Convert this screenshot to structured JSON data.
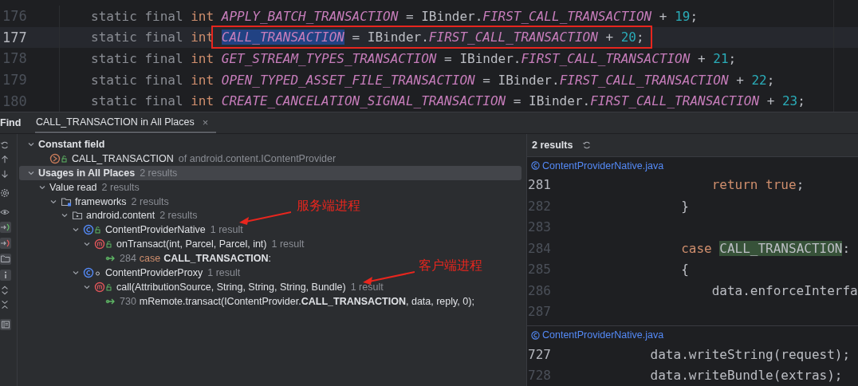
{
  "editor": {
    "lines": [
      {
        "number": "176",
        "current": false,
        "tokens": [
          {
            "t": "static final ",
            "kind": "keyword"
          },
          {
            "t": "int ",
            "kind": "type"
          },
          {
            "t": "APPLY_BATCH_TRANSACTION",
            "kind": "const"
          },
          {
            "t": " = IBinder.",
            "kind": "plain"
          },
          {
            "t": "FIRST_CALL_TRANSACTION",
            "kind": "const"
          },
          {
            "t": " + ",
            "kind": "plain"
          },
          {
            "t": "19",
            "kind": "number"
          },
          {
            "t": ";",
            "kind": "plain"
          }
        ]
      },
      {
        "number": "177",
        "current": true,
        "tokens": [
          {
            "t": "static final ",
            "kind": "keyword"
          },
          {
            "t": "int ",
            "kind": "type"
          }
        ],
        "boxed_tokens": [
          {
            "t": "CALL_TRANSACTION",
            "kind": "const",
            "selected": true
          },
          {
            "t": " = IBinder.",
            "kind": "plain"
          },
          {
            "t": "FIRST_CALL_TRANSACTION",
            "kind": "const"
          },
          {
            "t": " + ",
            "kind": "plain"
          },
          {
            "t": "20",
            "kind": "number"
          },
          {
            "t": ";",
            "kind": "plain"
          }
        ]
      },
      {
        "number": "178",
        "current": false,
        "tokens": [
          {
            "t": "static final ",
            "kind": "keyword"
          },
          {
            "t": "int ",
            "kind": "type"
          },
          {
            "t": "GET_STREAM_TYPES_TRANSACTION",
            "kind": "const"
          },
          {
            "t": " = IBinder.",
            "kind": "plain"
          },
          {
            "t": "FIRST_CALL_TRANSACTION",
            "kind": "const"
          },
          {
            "t": " + ",
            "kind": "plain"
          },
          {
            "t": "21",
            "kind": "number"
          },
          {
            "t": ";",
            "kind": "plain"
          }
        ]
      },
      {
        "number": "179",
        "current": false,
        "tokens": [
          {
            "t": "static final ",
            "kind": "keyword"
          },
          {
            "t": "int ",
            "kind": "type"
          },
          {
            "t": "OPEN_TYPED_ASSET_FILE_TRANSACTION",
            "kind": "const"
          },
          {
            "t": " = IBinder.",
            "kind": "plain"
          },
          {
            "t": "FIRST_CALL_TRANSACTION",
            "kind": "const"
          },
          {
            "t": " + ",
            "kind": "plain"
          },
          {
            "t": "22",
            "kind": "number"
          },
          {
            "t": ";",
            "kind": "plain"
          }
        ]
      },
      {
        "number": "180",
        "current": false,
        "tokens": [
          {
            "t": "static final ",
            "kind": "keyword"
          },
          {
            "t": "int ",
            "kind": "type"
          },
          {
            "t": "CREATE_CANCELATION_SIGNAL_TRANSACTION",
            "kind": "const"
          },
          {
            "t": " = IBinder.",
            "kind": "plain"
          },
          {
            "t": "FIRST_CALL_TRANSACTION",
            "kind": "const"
          },
          {
            "t": " + ",
            "kind": "plain"
          },
          {
            "t": "23",
            "kind": "number"
          },
          {
            "t": ";",
            "kind": "plain"
          }
        ]
      }
    ]
  },
  "find": {
    "title": "Find",
    "tabs": [
      {
        "label": "CALL_TRANSACTION in All Places",
        "selected": true,
        "close": "×"
      }
    ],
    "tree": [
      {
        "kind": "group",
        "label": "Constant field",
        "expanded": true,
        "selected": false,
        "children": [
          {
            "kind": "field",
            "label": "CALL_TRANSACTION",
            "detail": "of android.content.IContentProvider",
            "selected": false
          }
        ]
      },
      {
        "kind": "group",
        "label": "Usages in All Places",
        "count": "2 results",
        "expanded": true,
        "selected": true,
        "children": [
          {
            "kind": "category",
            "label": "Value read",
            "count": "2 results",
            "expanded": true,
            "selected": false,
            "children": [
              {
                "kind": "folder",
                "label": "frameworks",
                "count": "2 results",
                "expanded": true,
                "selected": false,
                "children": [
                  {
                    "kind": "package",
                    "label": "android.content",
                    "count": "2 results",
                    "expanded": true,
                    "selected": false,
                    "children": [
                      {
                        "kind": "class",
                        "public": true,
                        "label": "ContentProviderNative",
                        "count": "1 result",
                        "expanded": true,
                        "selected": false,
                        "children": [
                          {
                            "kind": "method",
                            "public": true,
                            "label": "onTransact(int, Parcel, Parcel, int)",
                            "count": "1 result",
                            "expanded": true,
                            "selected": false,
                            "children": [
                              {
                                "kind": "usage",
                                "line": "284",
                                "keyword": "case",
                                "text": "**CALL_TRANSACTION**:",
                                "selected": false
                              }
                            ]
                          }
                        ]
                      },
                      {
                        "kind": "class",
                        "public": false,
                        "label": "ContentProviderProxy",
                        "count": "1 result",
                        "expanded": true,
                        "selected": false,
                        "children": [
                          {
                            "kind": "method",
                            "public": true,
                            "label": "call(AttributionSource, String, String, String, Bundle)",
                            "count": "1 result",
                            "expanded": true,
                            "selected": false,
                            "children": [
                              {
                                "kind": "usage",
                                "line": "730",
                                "text": "mRemote.transact(IContentProvider.**CALL_TRANSACTION**, data, reply, 0);",
                                "selected": false
                              }
                            ]
                          }
                        ]
                      }
                    ]
                  }
                ]
              }
            ]
          }
        ]
      }
    ],
    "annotations": [
      {
        "text": "服务端进程"
      },
      {
        "text": "客户端进程"
      }
    ],
    "preview": {
      "summary": "2 results",
      "files": [
        {
          "name": "ContentProviderNative.java",
          "lines": [
            {
              "number": "281",
              "emphasized": true,
              "tokens": [
                {
                  "t": "                    return true",
                  "kind": "control"
                },
                {
                  "t": ";",
                  "kind": "plain"
                }
              ]
            },
            {
              "number": "282",
              "emphasized": false,
              "tokens": [
                {
                  "t": "                }",
                  "kind": "plain"
                }
              ]
            },
            {
              "number": "283",
              "emphasized": false
            },
            {
              "number": "284",
              "emphasized": false,
              "tokens": [
                {
                  "t": "                case ",
                  "kind": "control"
                },
                {
                  "t": "CALL_TRANSACTION",
                  "kind": "match"
                },
                {
                  "t": ":",
                  "kind": "plain"
                }
              ]
            },
            {
              "number": "285",
              "emphasized": false,
              "tokens": [
                {
                  "t": "                {",
                  "kind": "plain"
                }
              ]
            },
            {
              "number": "286",
              "emphasized": false,
              "tokens": [
                {
                  "t": "                    data.enforceInterfa",
                  "kind": "plain"
                }
              ]
            },
            {
              "number": "287",
              "emphasized": false
            }
          ]
        },
        {
          "name": "ContentProviderNative.java",
          "lines": [
            {
              "number": "727",
              "emphasized": true,
              "tokens": [
                {
                  "t": "            data.writeString(request);",
                  "kind": "plain"
                }
              ]
            },
            {
              "number": "728",
              "emphasized": false,
              "tokens": [
                {
                  "t": "            data.writeBundle(extras);",
                  "kind": "plain"
                }
              ]
            }
          ]
        }
      ]
    }
  }
}
